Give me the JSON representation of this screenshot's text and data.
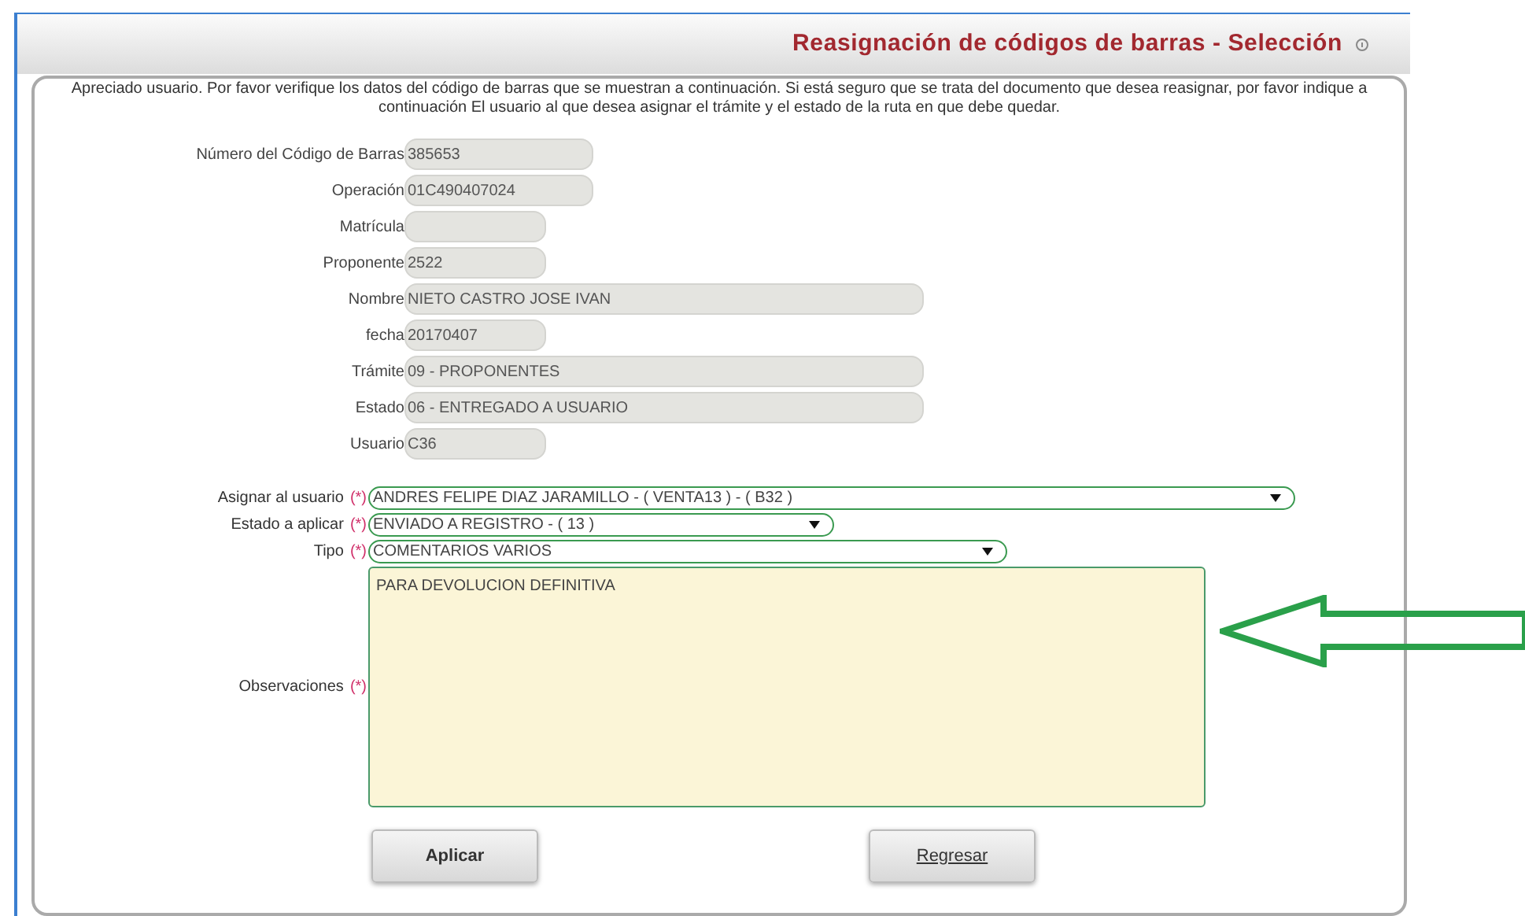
{
  "header": {
    "title": "Reasignación de códigos de barras - Selección"
  },
  "intro": "Apreciado usuario. Por favor verifique los datos del código de barras que se muestran a continuación. Si está seguro que se trata del documento que desea reasignar, por favor indique a continuación El usuario al que desea asignar el trámite y el estado de la ruta en que debe quedar.",
  "fields": [
    {
      "label": "Número del Código de Barras",
      "value": "385653",
      "kind": "medium"
    },
    {
      "label": "Operación",
      "value": "01C490407024",
      "kind": "medium"
    },
    {
      "label": "Matrícula",
      "kind": "narrow"
    },
    {
      "label": "Proponente",
      "value": "2522",
      "kind": "narrow"
    },
    {
      "label": "Nombre",
      "value": "NIETO CASTRO JOSE IVAN",
      "kind": "wide"
    },
    {
      "label": "fecha",
      "value": "20170407",
      "kind": "narrow"
    },
    {
      "label": "Trámite",
      "value": "09 - PROPONENTES",
      "kind": "wide"
    },
    {
      "label": "Estado",
      "value": "06 - ENTREGADO A USUARIO",
      "kind": "wide"
    },
    {
      "label": "Usuario",
      "value": "C36",
      "kind": "narrow"
    }
  ],
  "selects": [
    {
      "label": "Asignar al usuario",
      "required": "(*)",
      "value": "ANDRES FELIPE DIAZ JARAMILLO - ( VENTA13 ) - ( B32 )",
      "kind": "long"
    },
    {
      "label": "Estado a aplicar",
      "required": "(*)",
      "value": "ENVIADO A REGISTRO - ( 13 )",
      "kind": "short"
    },
    {
      "label": "Tipo",
      "required": "(*)",
      "value": "COMENTARIOS VARIOS",
      "kind": "medium"
    }
  ],
  "observations": {
    "label": "Observaciones",
    "required": "(*)",
    "value": "PARA DEVOLUCION DEFINITIVA"
  },
  "buttons": [
    {
      "label": "Aplicar",
      "underlined": false
    },
    {
      "label": "Regresar",
      "underlined": true
    }
  ]
}
